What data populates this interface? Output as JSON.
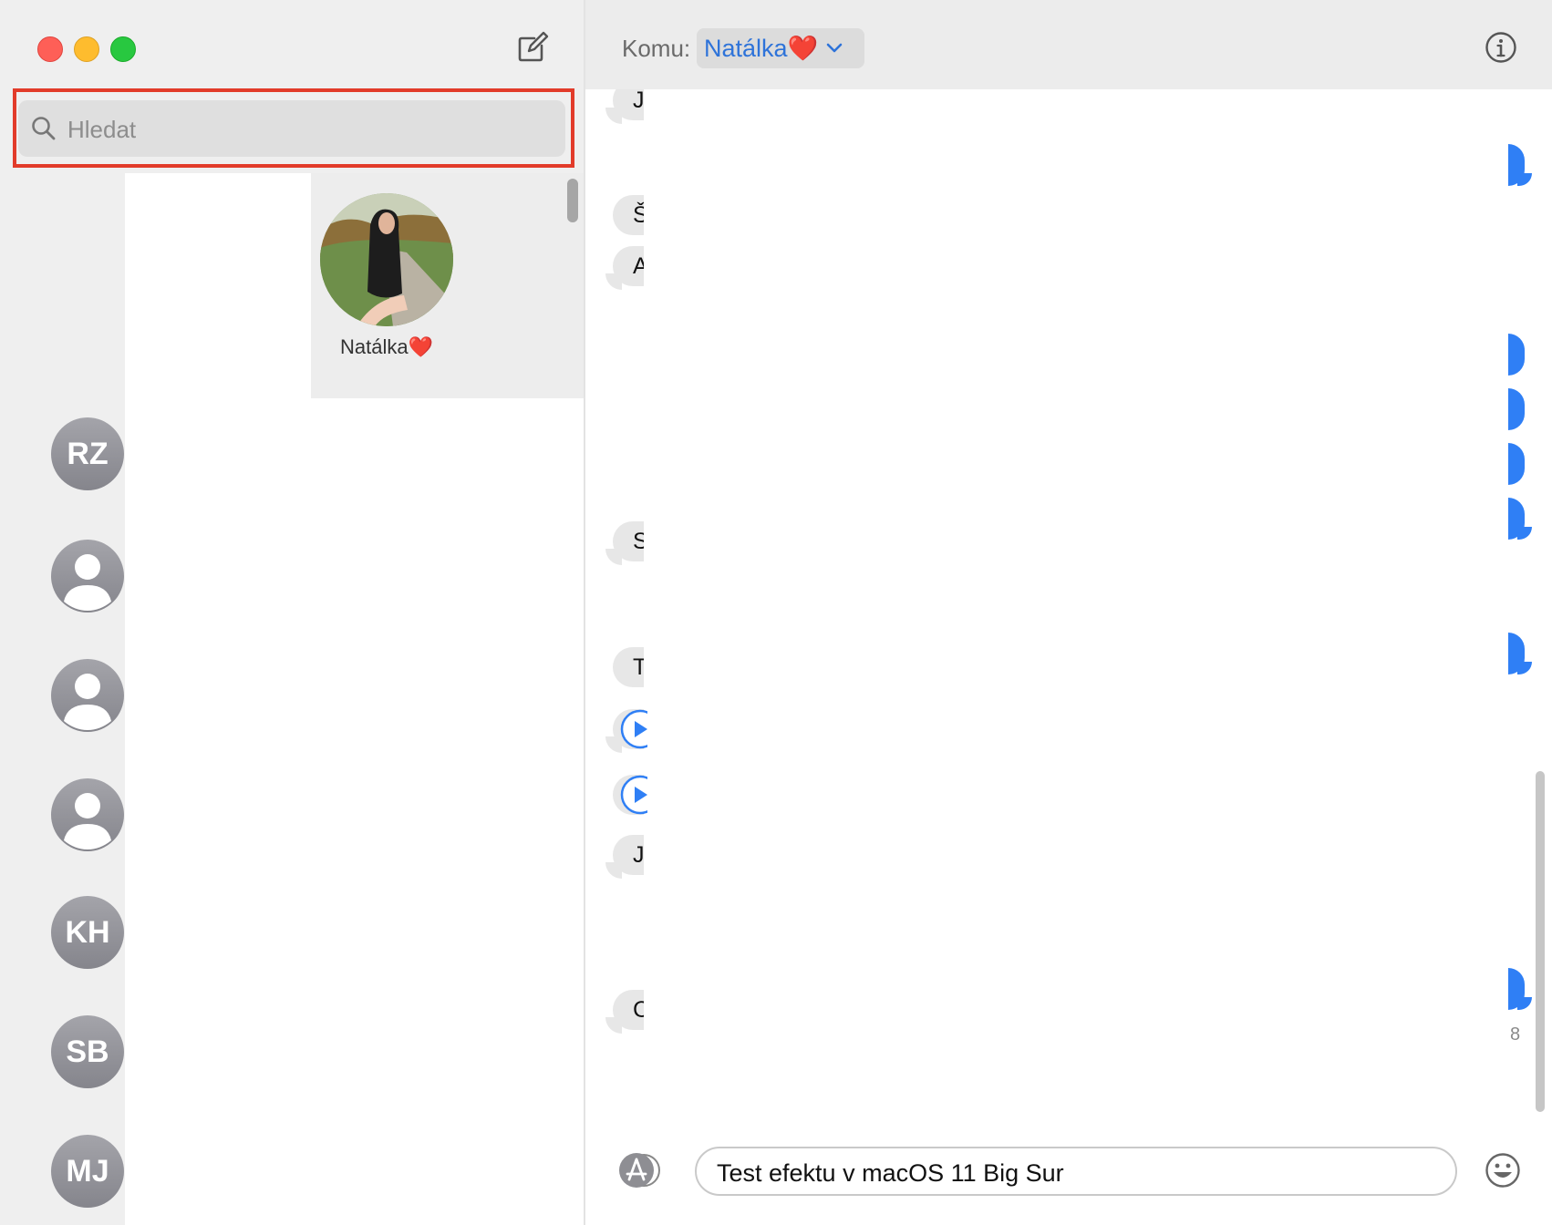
{
  "sidebar": {
    "search": {
      "placeholder": "Hledat",
      "value": ""
    },
    "pinned": {
      "name": "Natálka❤️"
    },
    "avatars": [
      {
        "initials": "RZ",
        "kind": "initials"
      },
      {
        "initials": "",
        "kind": "person-icon"
      },
      {
        "initials": "",
        "kind": "person-icon"
      },
      {
        "initials": "",
        "kind": "person-icon"
      },
      {
        "initials": "KH",
        "kind": "initials"
      },
      {
        "initials": "SB",
        "kind": "initials"
      },
      {
        "initials": "MJ",
        "kind": "initials"
      }
    ]
  },
  "header": {
    "to_label": "Komu:",
    "recipient": "Natálka❤️"
  },
  "transcript": {
    "left_fragments": [
      "J",
      "Š",
      "A",
      "S",
      "T",
      "J",
      "C"
    ],
    "timestamp_fragment": "8"
  },
  "composer": {
    "message_value": "Test efektu v macOS 11 Big Sur"
  },
  "icons": {
    "compose": "compose-icon",
    "search": "search-icon",
    "info": "info-icon",
    "apps": "app-store-icon",
    "emoji": "emoji-icon",
    "chevron": "chevron-down-icon"
  },
  "colors": {
    "accent": "#2f7ff5",
    "highlight": "#e23b2a",
    "recipient_text": "#2e73d9"
  }
}
